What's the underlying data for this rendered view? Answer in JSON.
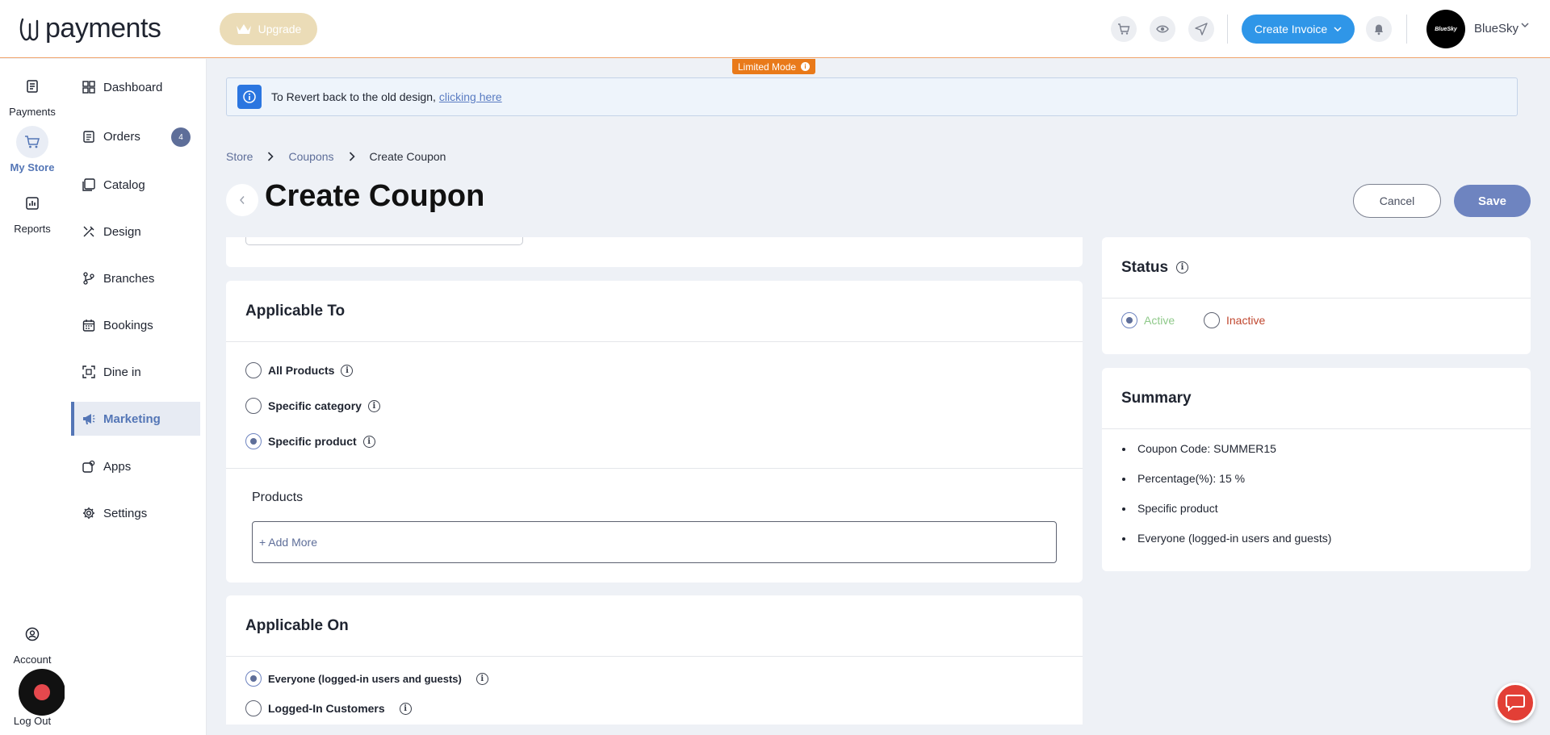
{
  "header": {
    "logo_text": "payments",
    "upgrade_label": "Upgrade",
    "create_invoice_label": "Create Invoice",
    "avatar_text": "BlueSky",
    "user_name": "BlueSky",
    "limited_mode_label": "Limited Mode"
  },
  "rail": {
    "items": [
      {
        "label": "Payments",
        "icon": "receipt-icon"
      },
      {
        "label": "My Store",
        "icon": "cart-icon",
        "active": true
      },
      {
        "label": "Reports",
        "icon": "bar-chart-icon"
      }
    ],
    "account_label": "Account",
    "logout_label": "Log Out"
  },
  "sidebar": {
    "items": [
      {
        "label": "Dashboard",
        "icon": "dashboard-icon"
      },
      {
        "label": "Orders",
        "icon": "clipboard-icon",
        "badge": "4"
      },
      {
        "label": "Catalog",
        "icon": "catalog-icon"
      },
      {
        "label": "Design",
        "icon": "design-icon"
      },
      {
        "label": "Branches",
        "icon": "branch-icon"
      },
      {
        "label": "Bookings",
        "icon": "calendar-icon"
      },
      {
        "label": "Dine in",
        "icon": "qr-icon"
      },
      {
        "label": "Marketing",
        "icon": "megaphone-icon",
        "active": true
      },
      {
        "label": "Apps",
        "icon": "apps-icon"
      },
      {
        "label": "Settings",
        "icon": "gear-icon"
      }
    ]
  },
  "notice": {
    "text": "To Revert back to the old design,",
    "link": "clicking here"
  },
  "breadcrumb": {
    "items": [
      "Store",
      "Coupons",
      "Create Coupon"
    ]
  },
  "page": {
    "title": "Create Coupon",
    "cancel_label": "Cancel",
    "save_label": "Save"
  },
  "applicable_to": {
    "title": "Applicable To",
    "options": [
      "All Products",
      "Specific category",
      "Specific product"
    ],
    "selected": "Specific product",
    "products_label": "Products",
    "add_more_label": "+ Add More"
  },
  "applicable_on": {
    "title": "Applicable On",
    "options": [
      "Everyone (logged-in users and guests)",
      "Logged-In Customers"
    ],
    "selected": "Everyone (logged-in users and guests)"
  },
  "status": {
    "title": "Status",
    "active_label": "Active",
    "inactive_label": "Inactive",
    "selected": "Active"
  },
  "summary": {
    "title": "Summary",
    "items": [
      "Coupon Code: SUMMER15",
      "Percentage(%): 15 %",
      "Specific product",
      "Everyone (logged-in users and guests)"
    ]
  },
  "colors": {
    "accent": "#5476b6",
    "invoice_button": "#2f96e8",
    "limited_mode": "#e97a1a",
    "active_status": "#8fc98a",
    "inactive_status": "#c0472f"
  }
}
